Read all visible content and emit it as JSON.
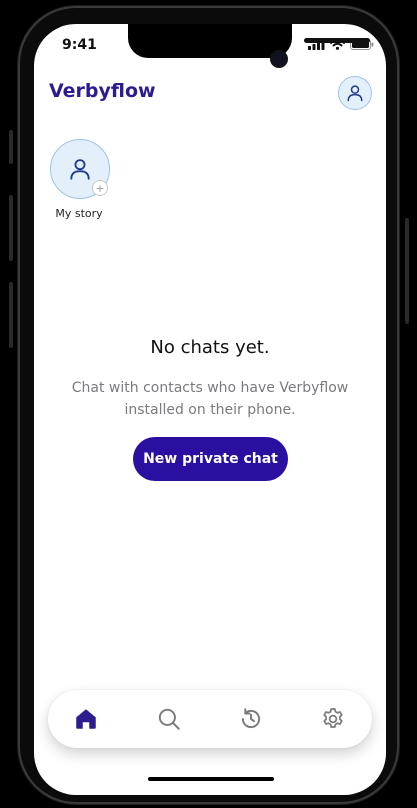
{
  "status_bar": {
    "time": "9:41",
    "icons": [
      "signal-icon",
      "wifi-icon",
      "battery-icon"
    ]
  },
  "header": {
    "brand": "Verbyflow",
    "profile_icon": "user-icon"
  },
  "stories": [
    {
      "label": "My story",
      "icon": "user-icon",
      "badge_icon": "plus-icon"
    }
  ],
  "empty_state": {
    "title": "No chats yet.",
    "description": "Chat with contacts who have Verbyflow installed on their phone.",
    "button_label": "New private chat"
  },
  "tab_bar": {
    "items": [
      {
        "id": "home",
        "icon": "home-icon",
        "active": true
      },
      {
        "id": "search",
        "icon": "search-icon",
        "active": false
      },
      {
        "id": "history",
        "icon": "history-icon",
        "active": false
      },
      {
        "id": "settings",
        "icon": "gear-icon",
        "active": false
      }
    ]
  },
  "colors": {
    "brand": "#2b1d8f",
    "button": "#2a0fa0",
    "avatar_bg": "#e3f0fb",
    "icon_stroke": "#1f3a8a"
  }
}
